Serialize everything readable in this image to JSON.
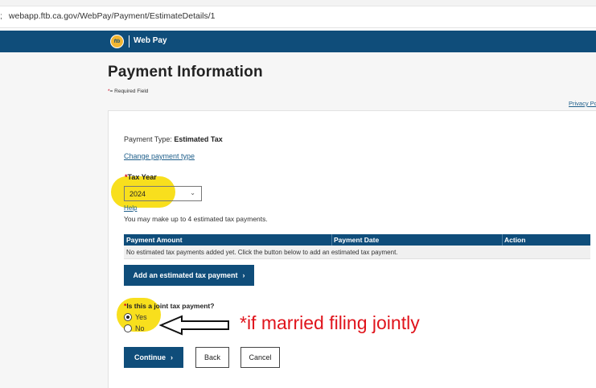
{
  "browser": {
    "url_lead": ";",
    "url": "webapp.ftb.ca.gov/WebPay/Payment/EstimateDetails/1"
  },
  "header": {
    "logo_text": "ftb",
    "brand": "Web Pay"
  },
  "page": {
    "title": "Payment Information",
    "required_star": "*",
    "required_note": "= Required Field",
    "privacy_link": "Privacy Po"
  },
  "payment_type": {
    "label": "Payment Type:",
    "value": "Estimated Tax",
    "change_link": "Change payment type"
  },
  "tax_year": {
    "required_star": "*",
    "label": "Tax Year",
    "selected": "2024",
    "help_link": "Help",
    "note": "You may make up to 4 estimated tax payments."
  },
  "payments_table": {
    "columns": [
      "Payment Amount",
      "Payment Date",
      "Action"
    ],
    "empty_message": "No estimated tax payments added yet. Click the button below to add an estimated tax payment."
  },
  "add_button": {
    "label": "Add an estimated tax payment",
    "chevron": "›"
  },
  "joint": {
    "required_star": "*",
    "question": "Is this a joint tax payment?",
    "options": [
      {
        "label": "Yes",
        "checked": true
      },
      {
        "label": "No",
        "checked": false
      }
    ]
  },
  "actions": {
    "continue": "Continue",
    "continue_chevron": "›",
    "back": "Back",
    "cancel": "Cancel"
  },
  "annotation": {
    "text": "*if married filing jointly",
    "color": "#e0141c",
    "highlight_color": "#f8df1d"
  },
  "colors": {
    "header_bg": "#0f4d7a",
    "link": "#1f5f8b",
    "required": "#d0021b"
  }
}
